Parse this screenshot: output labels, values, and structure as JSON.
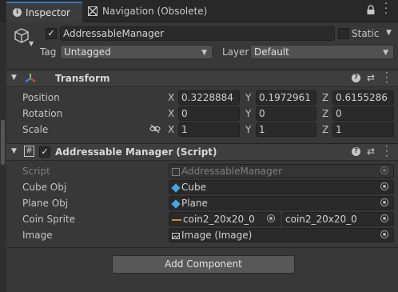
{
  "tabs": {
    "inspector": "Inspector",
    "navigation": "Navigation (Obsolete)"
  },
  "object": {
    "name": "AddressableManager",
    "static_label": "Static",
    "tag_label": "Tag",
    "tag_value": "Untagged",
    "layer_label": "Layer",
    "layer_value": "Default"
  },
  "transform": {
    "title": "Transform",
    "position_label": "Position",
    "rotation_label": "Rotation",
    "scale_label": "Scale",
    "position": {
      "x": "0.3228884",
      "y": "0.1972961",
      "z": "0.6155286"
    },
    "rotation": {
      "x": "0",
      "y": "0",
      "z": "0"
    },
    "scale": {
      "x": "1",
      "y": "1",
      "z": "1"
    },
    "axis_x": "X",
    "axis_y": "Y",
    "axis_z": "Z"
  },
  "script_component": {
    "title": "Addressable Manager (Script)",
    "script_label": "Script",
    "script_value": "AddressableManager",
    "cube_label": "Cube Obj",
    "cube_value": "Cube",
    "plane_label": "Plane Obj",
    "plane_value": "Plane",
    "coin_label": "Coin Sprite",
    "coin_value_a": "coin2_20x20_0",
    "coin_value_b": "coin2_20x20_0",
    "image_label": "Image",
    "image_value": "Image (Image)"
  },
  "add_component_label": "Add Component",
  "colors": {
    "background": "#383838",
    "field": "#2a2a2a",
    "header": "#3e3e3e",
    "cube_icon": "#4aa3df"
  }
}
